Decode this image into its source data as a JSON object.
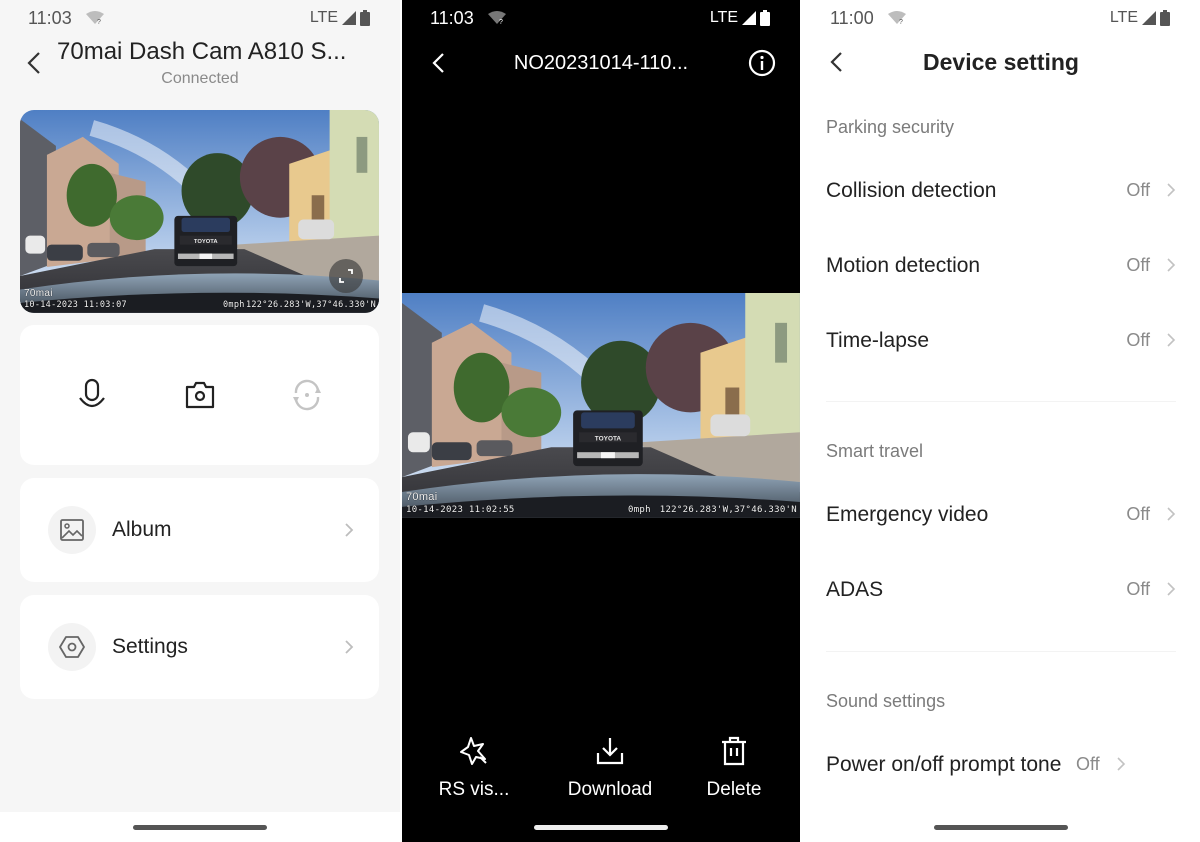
{
  "screens": [
    {
      "status": {
        "time": "11:03",
        "network": "LTE"
      },
      "header": {
        "title": "70mai Dash Cam A810 S...",
        "subtitle": "Connected"
      },
      "preview": {
        "brand_watermark": "70mai",
        "datetime": "10-14-2023 11:03:07",
        "speed": "0mph",
        "coords": "122°26.283'W,37°46.330'N",
        "plate_text": "TOYOTA"
      },
      "controls": [
        {
          "icon": "microphone-icon",
          "enabled": true
        },
        {
          "icon": "camera-icon",
          "enabled": true
        },
        {
          "icon": "switch-camera-icon",
          "enabled": false
        }
      ],
      "menu": [
        {
          "label": "Album",
          "icon": "image-icon"
        },
        {
          "label": "Settings",
          "icon": "hexagon-settings-icon"
        }
      ]
    },
    {
      "status": {
        "time": "11:03",
        "network": "LTE"
      },
      "header": {
        "title": "NO20231014-110..."
      },
      "video": {
        "brand_watermark": "70mai",
        "datetime": "10-14-2023 11:02:55",
        "speed": "0mph",
        "coords": "122°26.283'W,37°46.330'N",
        "plate_text": "TOYOTA"
      },
      "actions": [
        {
          "label": "RS vis...",
          "icon": "sparkle-star-icon"
        },
        {
          "label": "Download",
          "icon": "download-icon"
        },
        {
          "label": "Delete",
          "icon": "trash-icon"
        }
      ]
    },
    {
      "status": {
        "time": "11:00",
        "network": "LTE"
      },
      "header": {
        "title": "Device setting"
      },
      "sections": [
        {
          "title": "Parking security",
          "items": [
            {
              "label": "Collision detection",
              "value": "Off"
            },
            {
              "label": "Motion detection",
              "value": "Off"
            },
            {
              "label": "Time-lapse",
              "value": "Off"
            }
          ]
        },
        {
          "title": "Smart travel",
          "items": [
            {
              "label": "Emergency video",
              "value": "Off"
            },
            {
              "label": "ADAS",
              "value": "Off"
            }
          ]
        },
        {
          "title": "Sound settings",
          "items": [
            {
              "label": "Power on/off prompt tone",
              "value": "Off"
            }
          ]
        }
      ]
    }
  ]
}
